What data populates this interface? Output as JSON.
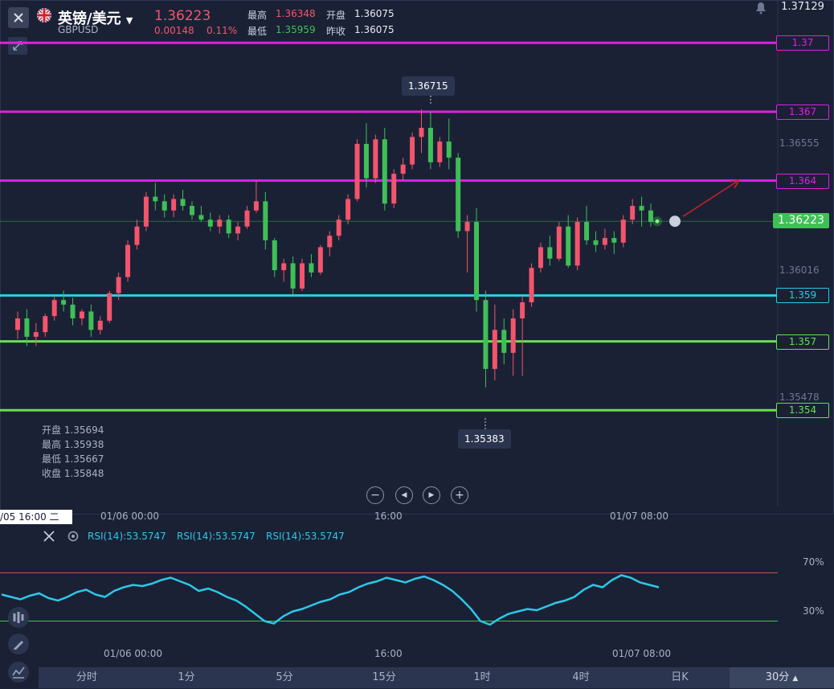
{
  "header": {
    "pair_name": "英镑/美元",
    "pair_code": "GBPUSD",
    "price": "1.36223",
    "change": "0.00148",
    "change_pct": "0.11%",
    "high_label": "最高",
    "high_value": "1.36348",
    "open_label": "开盘",
    "open_value": "1.36075",
    "low_label": "最低",
    "low_value": "1.35959",
    "prev_close_label": "昨收",
    "prev_close_value": "1.36075"
  },
  "price_axis": {
    "top_value": "1.37129",
    "ticks": [
      "1.36555",
      "1.36016",
      "1.35478"
    ],
    "current": "1.36223"
  },
  "levels": [
    {
      "label": "1.37",
      "color": "#e020e0"
    },
    {
      "label": "1.367",
      "color": "#e020e0"
    },
    {
      "label": "1.364",
      "color": "#e020e0"
    },
    {
      "label": "1.359",
      "color": "#2ec8e8"
    },
    {
      "label": "1.357",
      "color": "#66e050"
    },
    {
      "label": "1.354",
      "color": "#66e050"
    }
  ],
  "callouts": {
    "high": "1.36715",
    "low": "1.35383"
  },
  "ohlc_panel": {
    "open": "开盘 1.35694",
    "high": "最高 1.35938",
    "low": "最低 1.35667",
    "close": "收盘 1.35848"
  },
  "nav": {
    "zoom_out": "−",
    "prev": "◀",
    "next": "▶",
    "zoom_in": "+"
  },
  "time_axis": {
    "cursor": "/05 16:00 二",
    "labels": [
      "01/06 00:00",
      "16:00",
      "01/07 08:00"
    ]
  },
  "rsi": {
    "labels": [
      "RSI(14):53.5747",
      "RSI(14):53.5747",
      "RSI(14):53.5747"
    ],
    "level_high": "70%",
    "level_low": "30%"
  },
  "rsi_time_axis": {
    "labels": [
      "01/06 00:00",
      "16:00",
      "01/07 08:00"
    ]
  },
  "tabs": [
    "分时",
    "1分",
    "5分",
    "15分",
    "1时",
    "4时",
    "日K",
    "30分"
  ],
  "colors": {
    "up": "#f2556c",
    "down": "#3fbf56",
    "bg": "#1a2135",
    "rsi": "#2ec8e8"
  },
  "chart_data": {
    "type": "candlestick",
    "ylim": [
      1.3525,
      1.3725
    ],
    "candles": [
      [
        1.3575,
        1.3583,
        1.3571,
        1.358
      ],
      [
        1.358,
        1.3584,
        1.3568,
        1.3572
      ],
      [
        1.3572,
        1.3578,
        1.3568,
        1.3574
      ],
      [
        1.3574,
        1.3582,
        1.3572,
        1.3581
      ],
      [
        1.3581,
        1.359,
        1.3579,
        1.3588
      ],
      [
        1.3588,
        1.3592,
        1.3583,
        1.3586
      ],
      [
        1.3586,
        1.3589,
        1.3577,
        1.358
      ],
      [
        1.358,
        1.3584,
        1.3577,
        1.3583
      ],
      [
        1.3583,
        1.3586,
        1.3572,
        1.3575
      ],
      [
        1.3575,
        1.3581,
        1.3573,
        1.3579
      ],
      [
        1.3579,
        1.3592,
        1.3578,
        1.3591
      ],
      [
        1.3591,
        1.36,
        1.3588,
        1.3598
      ],
      [
        1.3598,
        1.3614,
        1.3596,
        1.3612
      ],
      [
        1.3612,
        1.3623,
        1.361,
        1.362
      ],
      [
        1.362,
        1.3635,
        1.3618,
        1.3633
      ],
      [
        1.3633,
        1.3639,
        1.3627,
        1.3631
      ],
      [
        1.3631,
        1.3634,
        1.3624,
        1.3627
      ],
      [
        1.3627,
        1.3634,
        1.3624,
        1.3632
      ],
      [
        1.3632,
        1.3636,
        1.3627,
        1.3629
      ],
      [
        1.3629,
        1.3631,
        1.3623,
        1.3625
      ],
      [
        1.3625,
        1.3629,
        1.3622,
        1.3623
      ],
      [
        1.3623,
        1.3626,
        1.3618,
        1.362
      ],
      [
        1.362,
        1.3625,
        1.3617,
        1.3623
      ],
      [
        1.3623,
        1.3625,
        1.3615,
        1.3617
      ],
      [
        1.3617,
        1.3622,
        1.3614,
        1.362
      ],
      [
        1.362,
        1.3629,
        1.3619,
        1.3627
      ],
      [
        1.3627,
        1.364,
        1.3626,
        1.3631
      ],
      [
        1.3631,
        1.3635,
        1.361,
        1.3614
      ],
      [
        1.3614,
        1.3615,
        1.3598,
        1.3601
      ],
      [
        1.3601,
        1.3606,
        1.3596,
        1.3604
      ],
      [
        1.3604,
        1.3607,
        1.359,
        1.3593
      ],
      [
        1.3593,
        1.3606,
        1.3592,
        1.3604
      ],
      [
        1.3604,
        1.3608,
        1.3598,
        1.36
      ],
      [
        1.36,
        1.3612,
        1.3599,
        1.3611
      ],
      [
        1.3611,
        1.3618,
        1.3607,
        1.3616
      ],
      [
        1.3616,
        1.3625,
        1.3614,
        1.3623
      ],
      [
        1.3623,
        1.3634,
        1.3621,
        1.3632
      ],
      [
        1.3632,
        1.3658,
        1.3631,
        1.3656
      ],
      [
        1.3656,
        1.3665,
        1.3637,
        1.3641
      ],
      [
        1.3641,
        1.366,
        1.3639,
        1.3658
      ],
      [
        1.3658,
        1.3663,
        1.3627,
        1.363
      ],
      [
        1.363,
        1.3645,
        1.3628,
        1.3643
      ],
      [
        1.3643,
        1.365,
        1.364,
        1.3647
      ],
      [
        1.3647,
        1.3661,
        1.3645,
        1.3659
      ],
      [
        1.3659,
        1.3671,
        1.3652,
        1.3663
      ],
      [
        1.3663,
        1.367,
        1.3645,
        1.3648
      ],
      [
        1.3648,
        1.3659,
        1.3646,
        1.3657
      ],
      [
        1.3657,
        1.3667,
        1.3645,
        1.365
      ],
      [
        1.365,
        1.3652,
        1.3615,
        1.3618
      ],
      [
        1.3618,
        1.3625,
        1.36,
        1.3622
      ],
      [
        1.3622,
        1.3628,
        1.3583,
        1.3588
      ],
      [
        1.3588,
        1.3592,
        1.355,
        1.3558
      ],
      [
        1.3558,
        1.3586,
        1.3553,
        1.3575
      ],
      [
        1.3575,
        1.358,
        1.356,
        1.3565
      ],
      [
        1.3565,
        1.3584,
        1.3555,
        1.358
      ],
      [
        1.358,
        1.359,
        1.3555,
        1.3587
      ],
      [
        1.3587,
        1.3604,
        1.3585,
        1.3602
      ],
      [
        1.3602,
        1.3613,
        1.36,
        1.3611
      ],
      [
        1.3611,
        1.3616,
        1.3603,
        1.3606
      ],
      [
        1.3606,
        1.3622,
        1.3605,
        1.362
      ],
      [
        1.362,
        1.3625,
        1.3602,
        1.3603
      ],
      [
        1.3603,
        1.3624,
        1.3601,
        1.3622
      ],
      [
        1.3622,
        1.3629,
        1.3612,
        1.3614
      ],
      [
        1.3614,
        1.3618,
        1.3609,
        1.3612
      ],
      [
        1.3612,
        1.3619,
        1.361,
        1.3615
      ],
      [
        1.3615,
        1.3618,
        1.3608,
        1.3613
      ],
      [
        1.3613,
        1.3625,
        1.3611,
        1.3623
      ],
      [
        1.3623,
        1.3632,
        1.3621,
        1.3629
      ],
      [
        1.3629,
        1.3633,
        1.362,
        1.3627
      ],
      [
        1.3627,
        1.363,
        1.362,
        1.3622
      ]
    ],
    "rsi": [
      52,
      50,
      48,
      51,
      53,
      49,
      47,
      50,
      54,
      56,
      52,
      50,
      55,
      58,
      60,
      59,
      61,
      64,
      66,
      63,
      60,
      55,
      57,
      54,
      50,
      47,
      42,
      36,
      30,
      28,
      34,
      38,
      40,
      43,
      46,
      48,
      52,
      54,
      58,
      61,
      63,
      66,
      64,
      62,
      65,
      67,
      64,
      60,
      55,
      48,
      40,
      30,
      27,
      32,
      36,
      38,
      40,
      39,
      42,
      45,
      47,
      50,
      56,
      60,
      58,
      64,
      68,
      66,
      62,
      60,
      58
    ],
    "rsi_levels": [
      70,
      30
    ]
  }
}
